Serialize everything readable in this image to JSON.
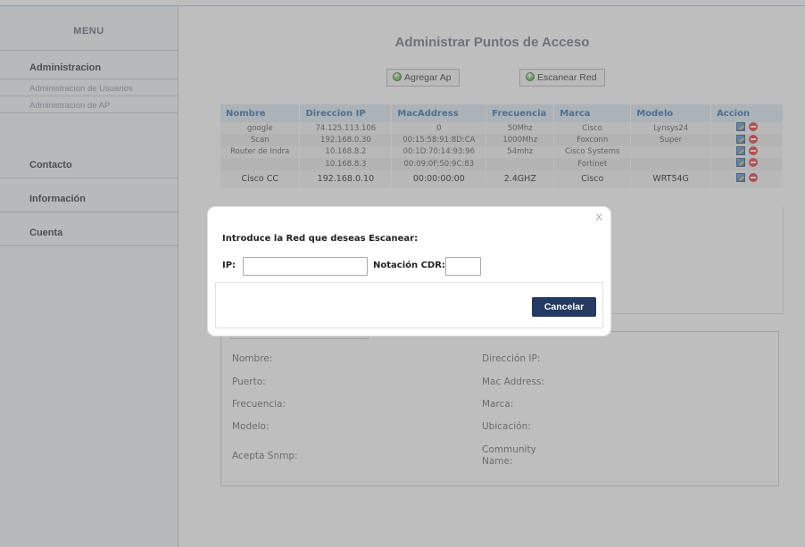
{
  "sidebar": {
    "menu_title": "MENU",
    "admin": "Administracion",
    "admin_users": "Administracion de Usuarios",
    "admin_ap": "Administracion de AP",
    "contact": "Contacto",
    "info": "Información",
    "account": "Cuenta"
  },
  "main": {
    "title": "Administrar Puntos de Acceso",
    "add_ap": "Agregar Ap",
    "scan_net": "Escanear Red"
  },
  "table": {
    "headers": [
      "Nombre",
      "Direccion IP",
      "MacAddress",
      "Frecuencia",
      "Marca",
      "Modelo",
      "Accion"
    ],
    "rows": [
      [
        "google",
        "74.125.113.106",
        "0",
        "50Mhz",
        "Cisco",
        "Lynsys24"
      ],
      [
        "Scan",
        "192.168.0.30",
        "00:15:58:91:8D:CA",
        "1000Mhz",
        "Foxconn",
        "Super"
      ],
      [
        "Router de Indra",
        "10.168.8.2",
        "00:1D:70:14:93:96",
        "54mhz",
        "Cisco Systems",
        ""
      ],
      [
        "",
        "10.168.8.3",
        "00:09:0F:50:9C:83",
        "",
        "Fortinet",
        ""
      ],
      [
        "Cisco CC",
        "192.168.0.10",
        "00:00:00:00",
        "2.4GHZ",
        "Cisco",
        "WRT54G"
      ]
    ]
  },
  "details": {
    "nombre": "Nombre:",
    "puerto": "Puerto:",
    "frecuencia": "Frecuencia:",
    "modelo": "Modelo:",
    "snmp": "Acepta Snmp:",
    "ip": "Dirección IP:",
    "mac": "Mac Address:",
    "marca": "Marca:",
    "ubicacion": "Ubicación:",
    "community_1": "Community",
    "community_2": "Name:"
  },
  "modal": {
    "close": "X",
    "title": "Introduce la Red que deseas Escanear:",
    "ip_label": "IP:",
    "ip_value": "",
    "cdr_label": "Notación CDR:",
    "cdr_value": "",
    "cancel": "Cancelar"
  },
  "colors": {
    "cancel_button": "#243a63",
    "table_header_text": "#3a6fa8",
    "table_header_bg": "#dce9f5"
  }
}
